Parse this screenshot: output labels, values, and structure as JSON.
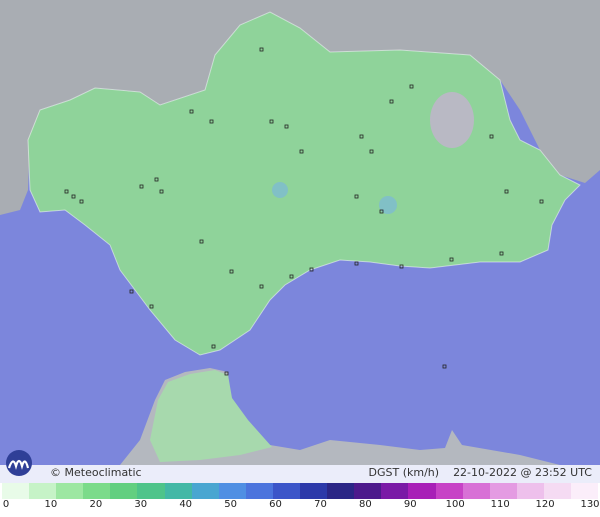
{
  "caption": {
    "brand": "© Meteoclimatic",
    "variable": "DGST (km/h)",
    "datetime": "22-10-2022 @ 23:52 UTC"
  },
  "legend": {
    "ticks": [
      "0",
      "10",
      "20",
      "30",
      "40",
      "50",
      "60",
      "70",
      "80",
      "90",
      "100",
      "110",
      "120",
      "130"
    ],
    "colors": [
      "#e8fbe8",
      "#c6f3c7",
      "#9de7a2",
      "#7bdb8a",
      "#62cf80",
      "#4ec48a",
      "#43b8a6",
      "#49a6d1",
      "#4f8fe3",
      "#4b74dd",
      "#3b55c9",
      "#2c39a9",
      "#2b2686",
      "#4d1a8c",
      "#7a1aa6",
      "#a81fb7",
      "#c742c6",
      "#d870d6",
      "#e49be2",
      "#eec0ec",
      "#f5dbf3",
      "#fbeefa"
    ]
  },
  "colors": {
    "sea": "#7c86dc",
    "land_outside": "#a9adb3",
    "andalusia": "#8fd39a",
    "ceuta": "#a7d9ad"
  }
}
